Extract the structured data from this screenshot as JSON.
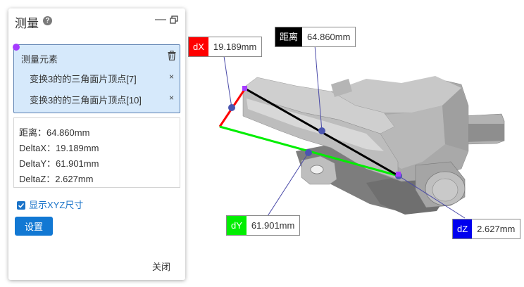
{
  "panel": {
    "title": "测量",
    "elements_title": "测量元素",
    "elements": [
      {
        "label": "变换3的的三角面片顶点[7]",
        "remove": "×"
      },
      {
        "label": "变换3的的三角面片顶点[10]",
        "remove": "×"
      }
    ],
    "results": [
      "距离：64.860mm",
      "DeltaX：19.189mm",
      "DeltaY：61.901mm",
      "DeltaZ：2.627mm"
    ],
    "show_xyz_label": "显示XYZ尺寸",
    "show_xyz_checked": true,
    "settings_label": "设置",
    "close_label": "关闭"
  },
  "viewport": {
    "labels": {
      "dx": {
        "tag": "dX",
        "value": "19.189mm",
        "color": "#ff0000"
      },
      "distance": {
        "tag": "距离",
        "value": "64.860mm",
        "color": "#000000"
      },
      "dy": {
        "tag": "dY",
        "value": "61.901mm",
        "color": "#00ee00"
      },
      "dz": {
        "tag": "dZ",
        "value": "2.627mm",
        "color": "#0000ee"
      }
    }
  },
  "colors": {
    "accent": "#1278d3",
    "selection_bg": "#d6e9fb",
    "point_marker": "#a63cff",
    "part_gray": "#9a9a9a"
  }
}
